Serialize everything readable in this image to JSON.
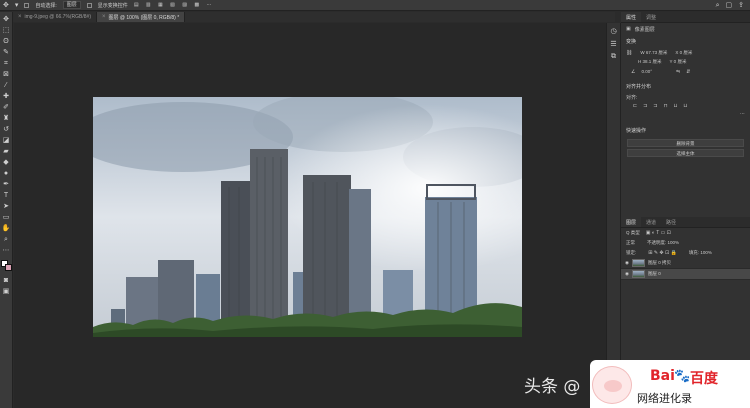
{
  "options_bar": {
    "auto_select_label": "自动选择:",
    "auto_select_value": "图层",
    "show_transform_label": "显示变换控件"
  },
  "tabs": [
    {
      "label": "img-9.jpeg @ 66.7%(RGB/8#)"
    },
    {
      "label": "图层, 图层 0, RGB/8) *",
      "full": "图层 @ 100% (图层 0, RGB/8) *"
    }
  ],
  "properties": {
    "tab_properties": "属性",
    "tab_adjust": "调整",
    "kind": "像素图层",
    "transform_title": "变换",
    "w": "W 67.73 厘米",
    "h": "H 38.1 厘米",
    "x": "X 0 厘米",
    "y": "Y 0 厘米",
    "angle": "0.00°",
    "align_title": "对齐并分布",
    "align_label": "对齐:",
    "quick_title": "快速操作",
    "remove_bg": "删除背景",
    "select_subject": "选择主体"
  },
  "layers": {
    "tab_layers": "图层",
    "tab_channels": "通道",
    "tab_paths": "路径",
    "kind_filter": "Q 类型",
    "blend_mode": "正常",
    "opacity_label": "不透明度: 100%",
    "lock_label": "锁定:",
    "fill_label": "填充: 100%",
    "items": [
      {
        "name": "图层 0 拷贝"
      },
      {
        "name": "图层 0"
      }
    ]
  },
  "watermark": {
    "toutiao": "头条 @",
    "baidu_brand": "Bai",
    "baidu_brand2": "百度",
    "baidu_sub": "网络进化录"
  },
  "colors": {
    "foreground": "#ffffff",
    "background": "#d9a0b3"
  }
}
